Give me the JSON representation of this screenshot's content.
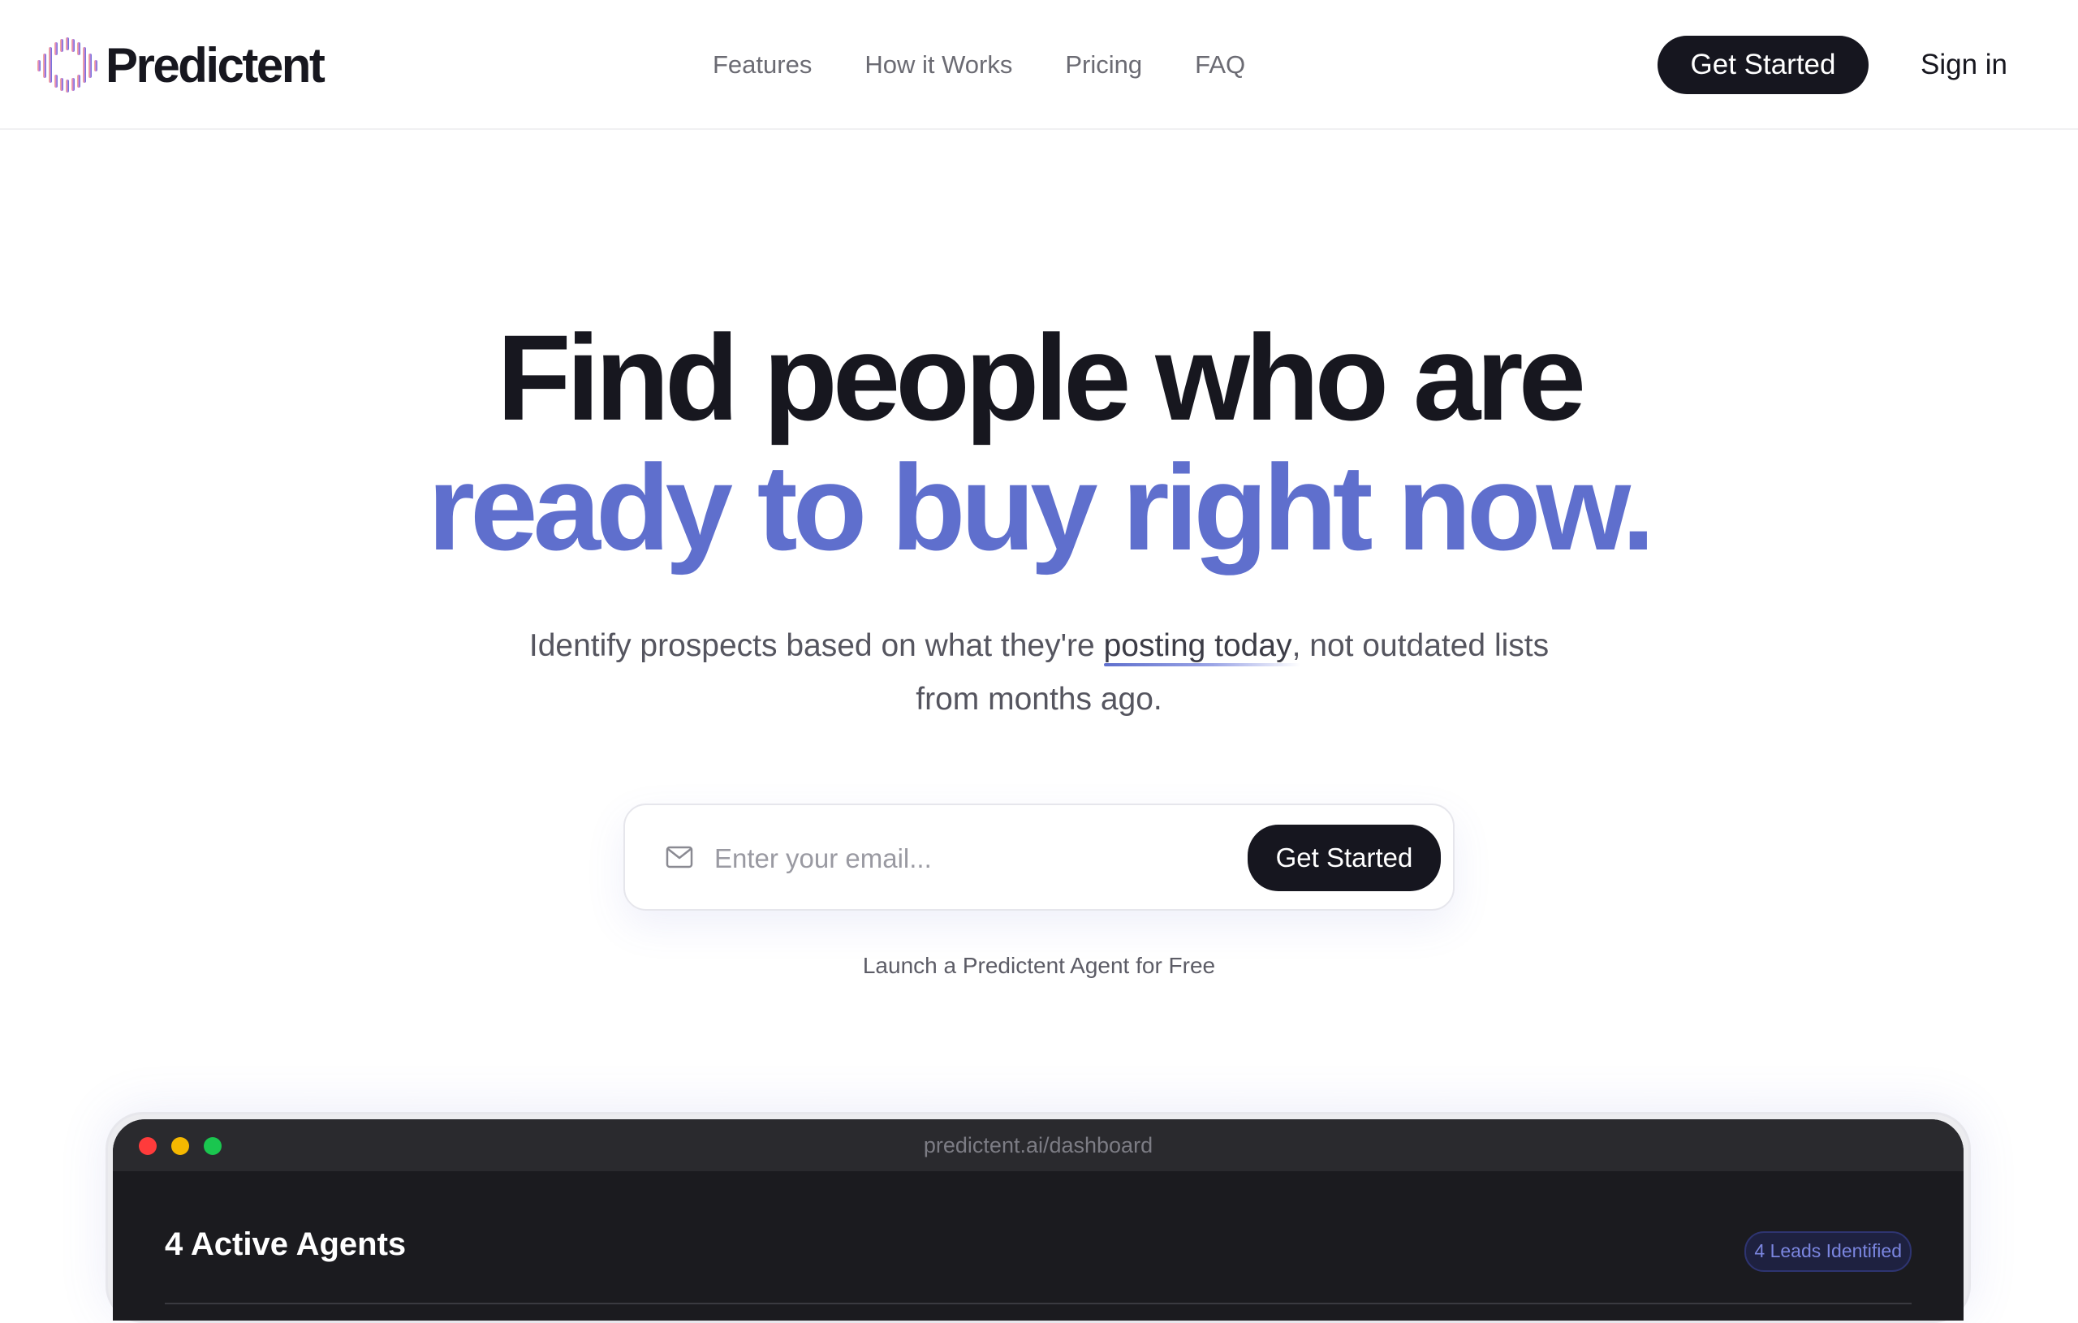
{
  "brand": {
    "name": "Predictent"
  },
  "nav": {
    "items": [
      "Features",
      "How it Works",
      "Pricing",
      "FAQ"
    ]
  },
  "header": {
    "cta_label": "Get Started",
    "signin_label": "Sign in"
  },
  "hero": {
    "line1": "Find people who are",
    "line2": "ready to buy right now.",
    "subtitle_before": "Identify prospects based on what they're ",
    "subtitle_highlight": "posting today",
    "subtitle_after": ", not outdated lists",
    "subtitle_line2": "from months ago."
  },
  "signup": {
    "email_placeholder": "Enter your email...",
    "email_value": "",
    "cta_label": "Get Started",
    "note": "Launch a Predictent Agent for Free"
  },
  "dashboard": {
    "url": "predictent.ai/dashboard",
    "title": "4 Active Agents",
    "leads_badge": "4 Leads Identified"
  },
  "colors": {
    "accent": "#5f6fcd",
    "dark": "#16161f",
    "window_bg": "#1b1b1f",
    "dot_red": "#ff3b3b",
    "dot_yellow": "#f5b800",
    "dot_green": "#1ac64f"
  },
  "icons": {
    "logo": "predictent-logo-icon",
    "email": "mail-icon"
  }
}
